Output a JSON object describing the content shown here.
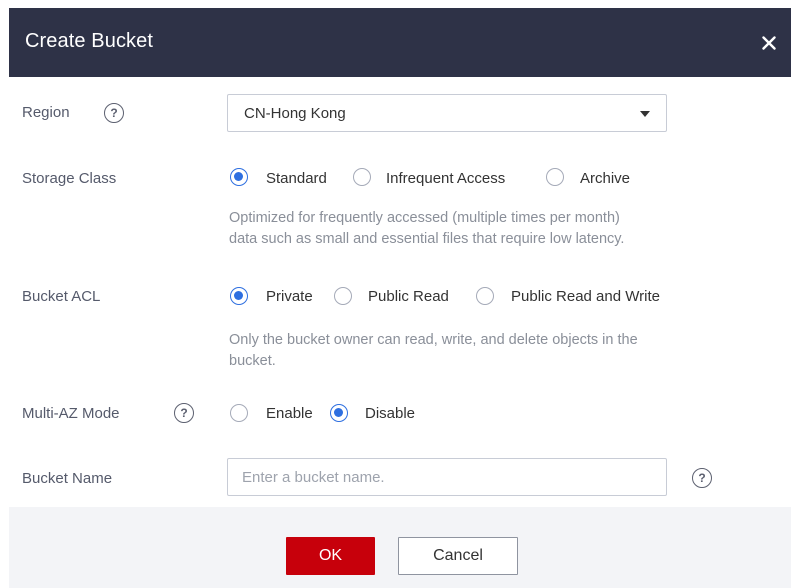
{
  "dialog": {
    "title": "Create Bucket",
    "close_icon": "close-icon",
    "header_color": "#2e3247"
  },
  "region": {
    "label": "Region",
    "help_icon": "?",
    "selected": "CN-Hong Kong"
  },
  "storage_class": {
    "label": "Storage Class",
    "options": [
      "Standard",
      "Infrequent Access",
      "Archive"
    ],
    "selected": "Standard",
    "description_line1": "Optimized for frequently accessed (multiple times per month)",
    "description_line2": "data such as small and essential files that require low latency."
  },
  "bucket_acl": {
    "label": "Bucket ACL",
    "options": [
      "Private",
      "Public Read",
      "Public Read and Write"
    ],
    "selected": "Private",
    "description_line1": "Only the bucket owner can read, write, and delete objects in the",
    "description_line2": "bucket."
  },
  "multi_az": {
    "label": "Multi-AZ Mode",
    "help_icon": "?",
    "options": [
      "Enable",
      "Disable"
    ],
    "selected": "Disable"
  },
  "bucket_name": {
    "label": "Bucket Name",
    "placeholder": "Enter a bucket name.",
    "value": "",
    "help_icon": "?"
  },
  "footer": {
    "ok_label": "OK",
    "cancel_label": "Cancel",
    "ok_color": "#c7000b",
    "radio_accent": "#2e6fe0"
  }
}
